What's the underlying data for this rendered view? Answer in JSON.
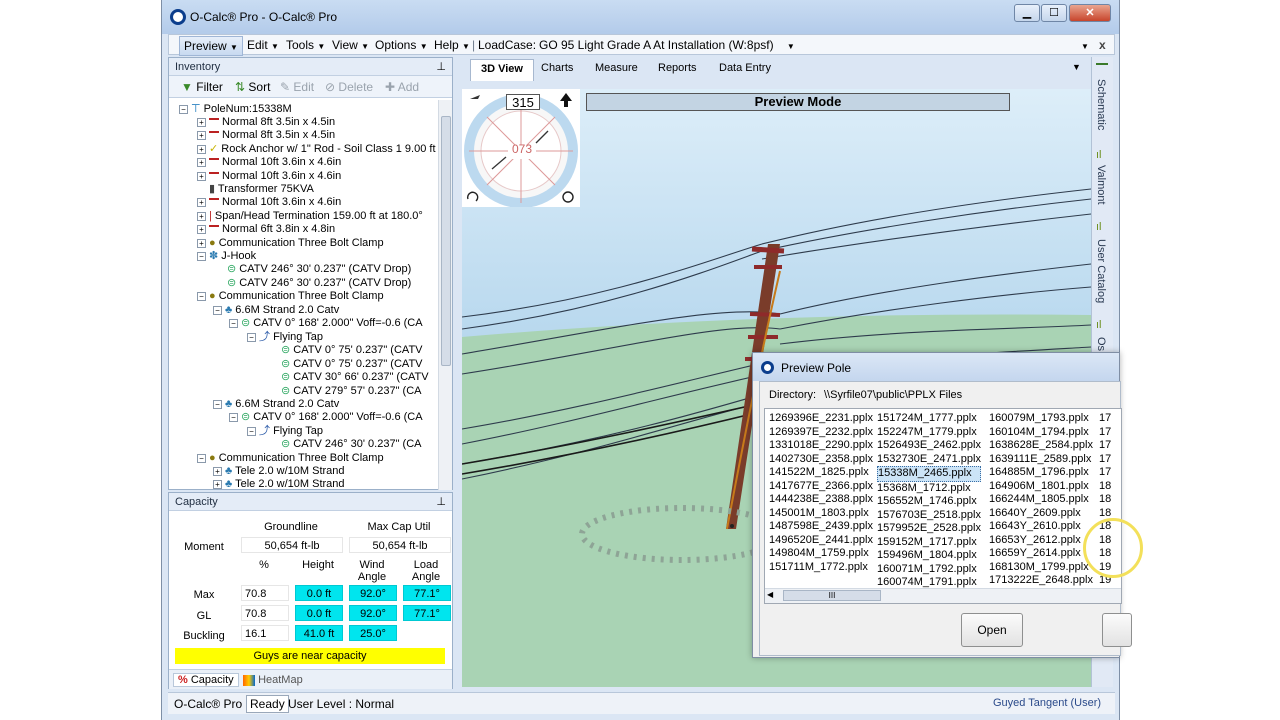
{
  "window": {
    "title": "O-Calc® Pro - O-Calc® Pro",
    "min": "▁",
    "max": "☐",
    "close": "✕"
  },
  "menu": {
    "items": [
      "Preview",
      "Edit",
      "Tools",
      "View",
      "Options",
      "Help"
    ],
    "loadcase_label": "LoadCase:",
    "loadcase_value": "GO 95 Light Grade A At Installation (W:8psf)",
    "close": "x"
  },
  "inventory": {
    "title": "Inventory",
    "toolbar": {
      "filter": "Filter",
      "sort": "Sort",
      "edit": "Edit",
      "delete": "Delete",
      "add": "Add"
    },
    "tree": [
      "PoleNum:15338M",
      "Normal 8ft  3.5in x 4.5in",
      "Normal 8ft  3.5in x 4.5in",
      "Rock Anchor w/ 1\" Rod - Soil Class 1 9.00 ft",
      "Normal 10ft  3.6in x 4.6in",
      "Normal 10ft  3.6in x 4.6in",
      "Transformer 75KVA",
      "Normal 10ft  3.6in x 4.6in",
      "Span/Head Termination 159.00 ft at 180.0°",
      "Normal 6ft  3.8in x 4.8in",
      "Communication Three Bolt Clamp",
      "J-Hook",
      "CATV 246° 30'  0.237\"  (CATV Drop)",
      "CATV 246° 30'  0.237\"  (CATV Drop)",
      "Communication Three Bolt Clamp",
      "6.6M Strand 2.0 Catv",
      "CATV 0° 168'  2.000\" Voff=-0.6  (CA",
      "Flying Tap",
      "CATV 0° 75'  0.237\"   (CATV",
      "CATV 0° 75'  0.237\"   (CATV",
      "CATV 30° 66'  0.237\"   (CATV",
      "CATV 279° 57'  0.237\"   (CA",
      "6.6M Strand 2.0 Catv",
      "CATV 0° 168'  2.000\" Voff=-0.6  (CA",
      "Flying Tap",
      "CATV 246° 30'  0.237\"   (CA",
      "Communication Three Bolt Clamp",
      "Tele 2.0 w/10M Strand",
      "Tele 2.0 w/10M Strand"
    ]
  },
  "capacity": {
    "title": "Capacity",
    "col_groundline": "Groundline",
    "col_maxcap": "Max Cap Util",
    "moment_label": "Moment",
    "moment_groundline": "50,654 ft-lb",
    "moment_maxcap": "50,654 ft-lb",
    "h_pct": "%",
    "h_height": "Height",
    "h_wind": "Wind Angle",
    "h_load": "Load Angle",
    "rows": [
      {
        "label": "Max",
        "pct": "70.8",
        "height": "0.0 ft",
        "wind": "92.0°",
        "load": "77.1°"
      },
      {
        "label": "GL",
        "pct": "70.8",
        "height": "0.0 ft",
        "wind": "92.0°",
        "load": "77.1°"
      },
      {
        "label": "Buckling",
        "pct": "16.1",
        "height": "41.0 ft",
        "wind": "25.0°",
        "load": ""
      }
    ],
    "warning": "Guys are near capacity",
    "tab_capacity": "Capacity",
    "tab_heatmap": "HeatMap"
  },
  "view": {
    "tabs": [
      "3D View",
      "Charts",
      "Measure",
      "Reports",
      "Data Entry"
    ],
    "preview_label": "Preview Mode",
    "compass_top": "315",
    "compass_center": "073"
  },
  "right_tabs": [
    "Schematic",
    "Valmont",
    "User Catalog",
    "Os"
  ],
  "status": {
    "app": "O-Calc® Pro",
    "ready": "Ready",
    "user_level": "User Level : Normal",
    "mode": "Guyed Tangent (User)"
  },
  "dialog": {
    "title": "Preview Pole",
    "directory_label": "Directory:",
    "directory_value": "\\\\Syrfile07\\public\\PPLX Files",
    "col1": [
      "1269396E_2231.pplx",
      "1269397E_2232.pplx",
      "1331018E_2290.pplx",
      "1402730E_2358.pplx",
      "141522M_1825.pplx",
      "1417677E_2366.pplx",
      "1444238E_2388.pplx",
      "145001M_1803.pplx",
      "1487598E_2439.pplx",
      "1496520E_2441.pplx",
      "149804M_1759.pplx",
      "151711M_1772.pplx"
    ],
    "col2": [
      "151724M_1777.pplx",
      "152247M_1779.pplx",
      "1526493E_2462.pplx",
      "1532730E_2471.pplx",
      "15338M_2465.pplx",
      "15368M_1712.pplx",
      "156552M_1746.pplx",
      "1576703E_2518.pplx",
      "1579952E_2528.pplx",
      "159152M_1717.pplx",
      "159496M_1804.pplx",
      "160071M_1792.pplx",
      "160074M_1791.pplx"
    ],
    "col3": [
      "160079M_1793.pplx",
      "160104M_1794.pplx",
      "1638628E_2584.pplx",
      "1639111E_2589.pplx",
      "164885M_1796.pplx",
      "164906M_1801.pplx",
      "166244M_1805.pplx",
      "16640Y_2609.pplx",
      "16643Y_2610.pplx",
      "16653Y_2612.pplx",
      "16659Y_2614.pplx",
      "168130M_1799.pplx",
      "1713222E_2648.pplx"
    ],
    "col4": [
      "17",
      "17",
      "17",
      "17",
      "17",
      "18",
      "18",
      "18",
      "18",
      "18",
      "18",
      "19",
      "19"
    ],
    "scroll_thumb": "III",
    "open_button": "Open"
  }
}
